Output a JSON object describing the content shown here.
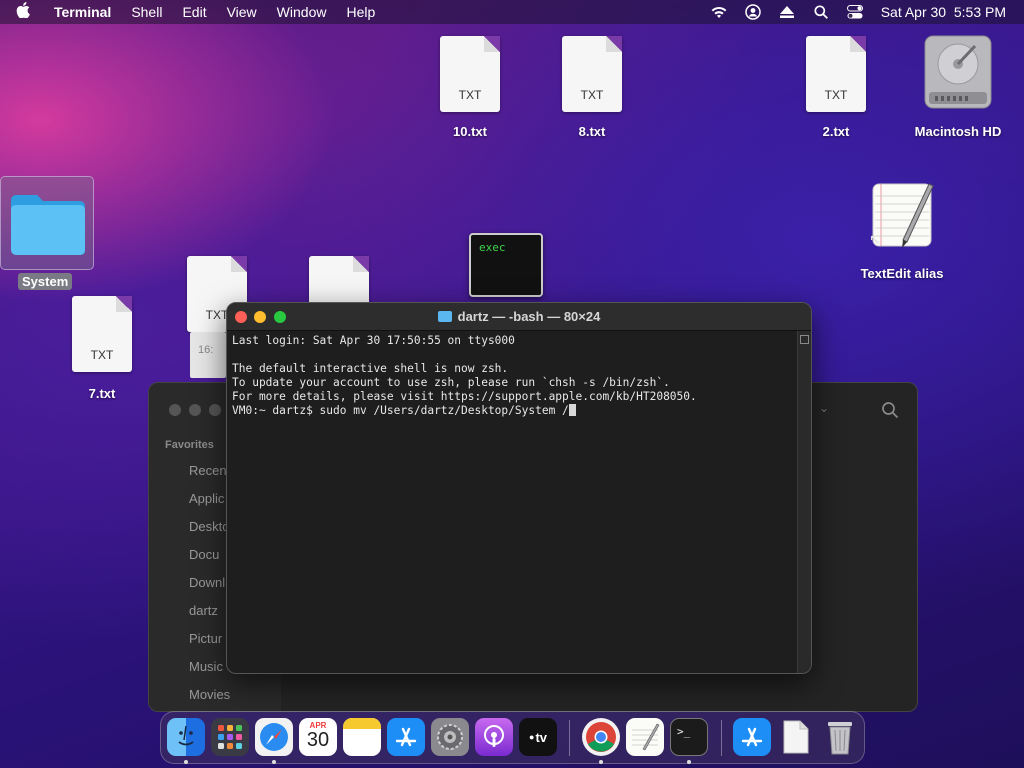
{
  "menubar": {
    "app": "Terminal",
    "items": [
      "Shell",
      "Edit",
      "View",
      "Window",
      "Help"
    ],
    "clock": "Sat Apr 30  5:53 PM"
  },
  "desktop": {
    "files": {
      "f10": {
        "label": "10.txt",
        "type": "TXT"
      },
      "f8": {
        "label": "8.txt",
        "type": "TXT"
      },
      "f2": {
        "label": "2.txt",
        "type": "TXT"
      },
      "f7": {
        "label": "7.txt",
        "type": "TXT"
      },
      "overlap1": {
        "type": "TXT"
      },
      "overlap_time": "16:"
    },
    "disk_label": "Macintosh HD",
    "folder_label": "System",
    "textedit_label": "TextEdit alias",
    "exec_label": "exec"
  },
  "terminal": {
    "title": "dartz — -bash — 80×24",
    "lines": [
      "Last login: Sat Apr 30 17:50:55 on ttys000",
      "",
      "The default interactive shell is now zsh.",
      "To update your account to use zsh, please run `chsh -s /bin/zsh`.",
      "For more details, please visit https://support.apple.com/kb/HT208050.",
      "VM0:~ dartz$ sudo mv /Users/dartz/Desktop/System /"
    ]
  },
  "finder": {
    "favorites_label": "Favorites",
    "items": [
      "Recen",
      "Applic",
      "Deskto",
      "Docu",
      "Downl",
      "dartz",
      "Pictur",
      "Music",
      "Movies"
    ]
  },
  "dock": {
    "calendar_month": "APR",
    "calendar_day": "30",
    "tv_label": "tv"
  }
}
